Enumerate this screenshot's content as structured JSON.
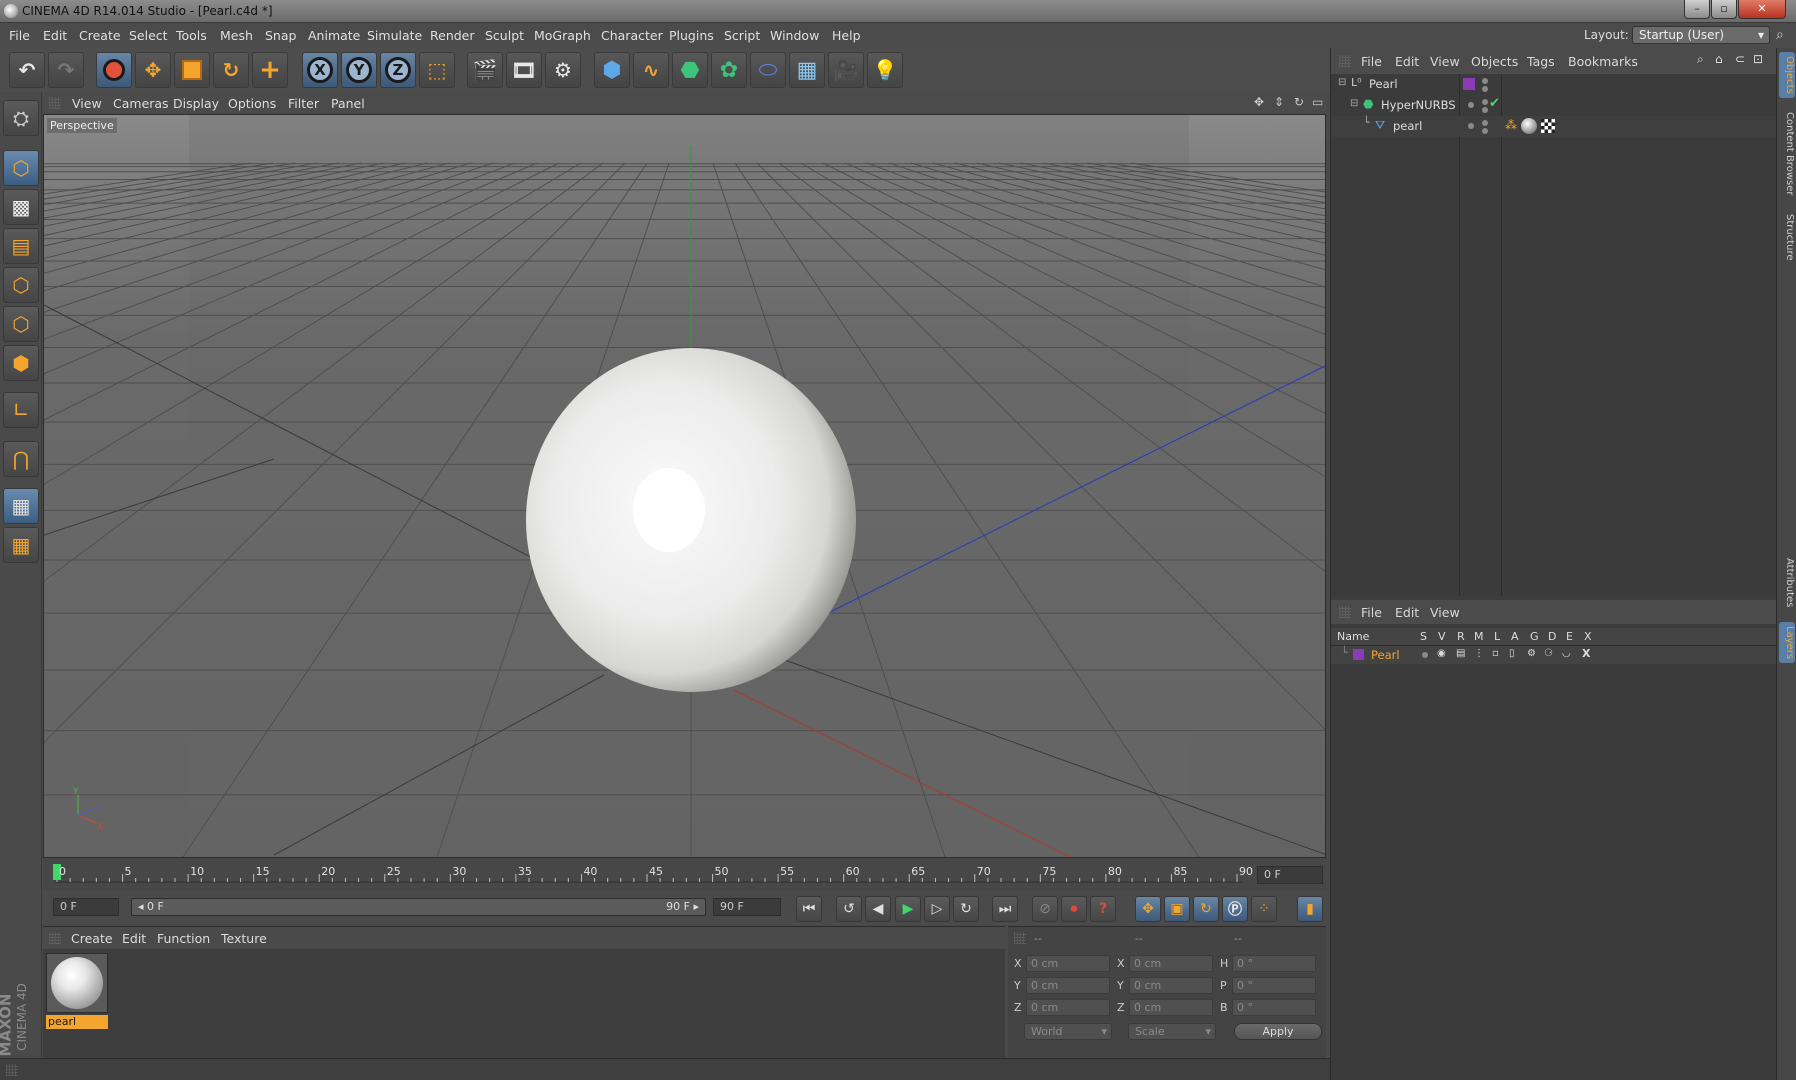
{
  "window": {
    "title": "CINEMA 4D R14.014 Studio - [Pearl.c4d *]",
    "minimize": "–",
    "maximize": "▫",
    "close": "✕"
  },
  "menubar": {
    "items": [
      "File",
      "Edit",
      "Create",
      "Select",
      "Tools",
      "Mesh",
      "Snap",
      "Animate",
      "Simulate",
      "Render",
      "Sculpt",
      "MoGraph",
      "Character",
      "Plugins",
      "Script",
      "Window",
      "Help"
    ],
    "layout_label": "Layout:",
    "layout_value": "Startup (User)"
  },
  "toolbar": {
    "axis_x": "X",
    "axis_y": "Y",
    "axis_z": "Z",
    "icons": [
      "undo-icon",
      "redo-icon",
      "live-selection-icon",
      "move-icon",
      "scale-icon",
      "rotate-icon",
      "add-icon",
      "lock-x-icon",
      "lock-y-icon",
      "lock-z-icon",
      "coordinate-system-icon",
      "render-view-icon",
      "render-picture-viewer-icon",
      "edit-render-settings-icon",
      "cube-icon",
      "spline-icon",
      "nurbs-icon",
      "array-icon",
      "deformer-icon",
      "scene-floor-icon",
      "camera-icon",
      "light-icon"
    ]
  },
  "viewport": {
    "menu": [
      "View",
      "Cameras",
      "Display",
      "Options",
      "Filter",
      "Panel"
    ],
    "label": "Perspective",
    "axis_x": "X",
    "axis_y": "Y",
    "axis_z": "Z"
  },
  "timeline": {
    "ticks": [
      "0",
      "5",
      "10",
      "15",
      "20",
      "25",
      "30",
      "35",
      "40",
      "45",
      "50",
      "55",
      "60",
      "65",
      "70",
      "75",
      "80",
      "85",
      "90"
    ],
    "current_frame": "0 F"
  },
  "transport": {
    "start_field": "0 F",
    "range_start": "◂ 0 F",
    "range_end": "90 F ▸",
    "end_field": "90 F"
  },
  "material_panel": {
    "menu": [
      "Create",
      "Edit",
      "Function",
      "Texture"
    ],
    "materials": [
      {
        "name": "pearl"
      }
    ]
  },
  "coordinates": {
    "headers": [
      "--",
      "--",
      "--"
    ],
    "pos_labels": [
      "X",
      "Y",
      "Z"
    ],
    "pos_values": [
      "0 cm",
      "0 cm",
      "0 cm"
    ],
    "size_labels": [
      "X",
      "Y",
      "Z"
    ],
    "size_values": [
      "0 cm",
      "0 cm",
      "0 cm"
    ],
    "rot_labels": [
      "H",
      "P",
      "B"
    ],
    "rot_values": [
      "0 °",
      "0 °",
      "0 °"
    ],
    "mode_world": "World",
    "mode_scale": "Scale",
    "apply": "Apply"
  },
  "object_manager": {
    "menu": [
      "File",
      "Edit",
      "View",
      "Objects",
      "Tags",
      "Bookmarks"
    ],
    "objects": [
      {
        "name": "Pearl",
        "type": "layer-null"
      },
      {
        "name": "HyperNURBS",
        "type": "hypernurbs"
      },
      {
        "name": "pearl",
        "type": "sphere"
      }
    ]
  },
  "layer_manager": {
    "menu": [
      "File",
      "Edit",
      "View"
    ],
    "columns": [
      "Name",
      "S",
      "V",
      "R",
      "M",
      "L",
      "A",
      "G",
      "D",
      "E",
      "X"
    ],
    "layers": [
      {
        "name": "Pearl",
        "color": "#8a3bb5"
      }
    ]
  },
  "side_tabs": [
    "Objects",
    "Content Browser",
    "Structure",
    "Attributes",
    "Layers"
  ],
  "brand": {
    "line1": "MAXON",
    "line2": "CINEMA 4D"
  },
  "colors": {
    "accent": "#f3a52e",
    "selection_blue": "#4e6f96",
    "layer_purple": "#8a3bb5",
    "axis_x": "#c0392b",
    "axis_y": "#2f9e2f",
    "axis_z": "#2b35c9"
  }
}
